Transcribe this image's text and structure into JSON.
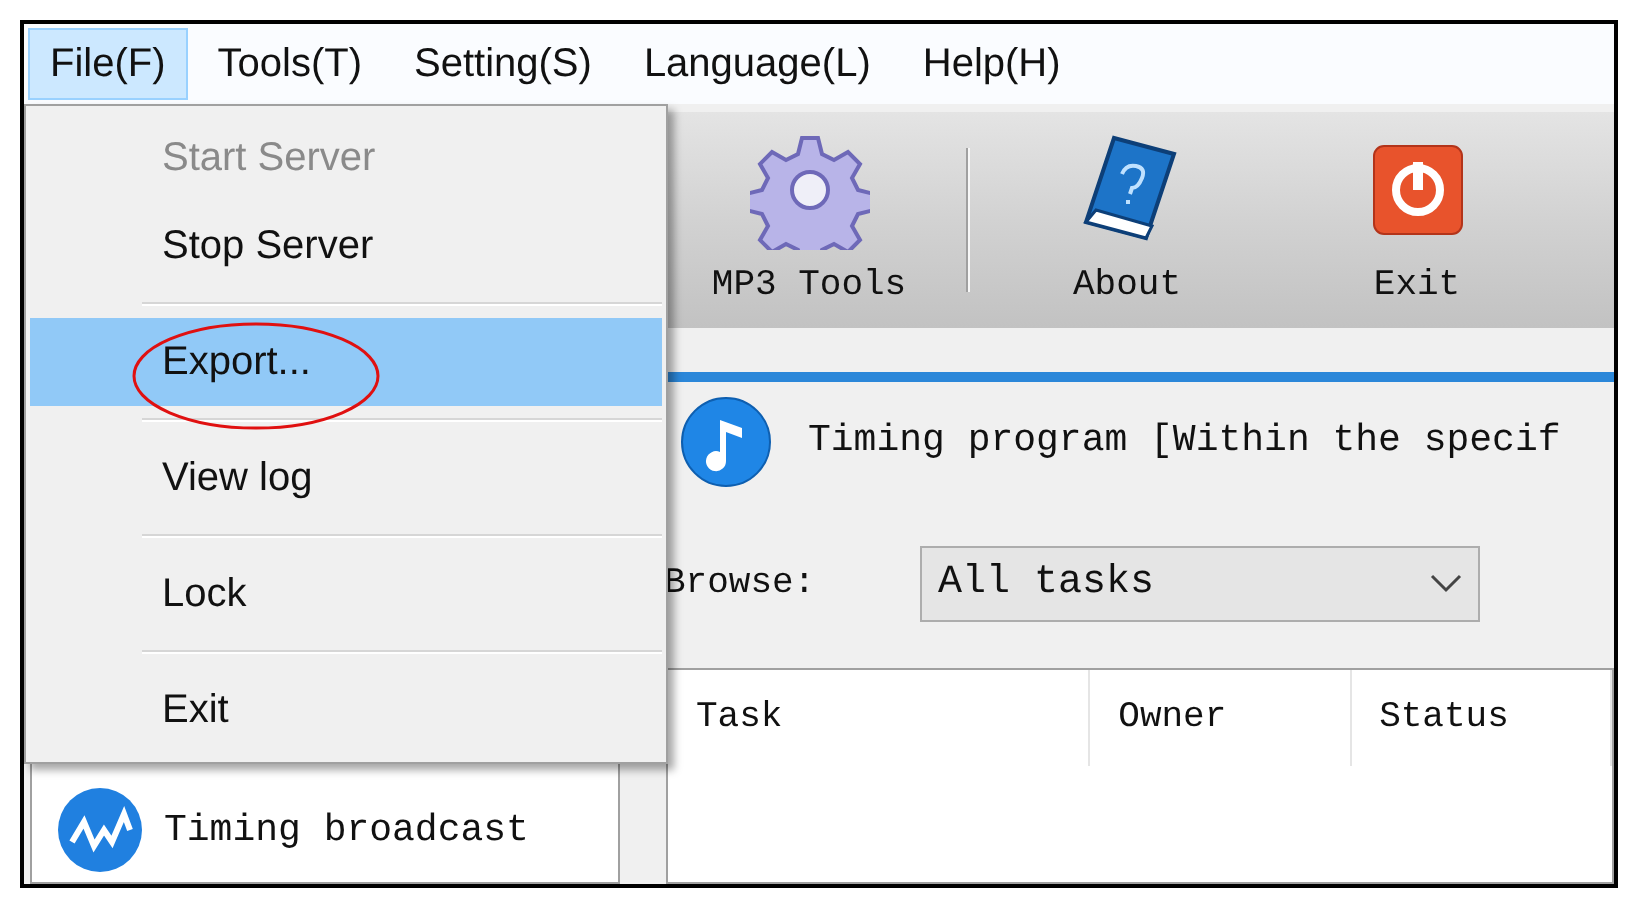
{
  "menu_bar": [
    {
      "label": "File(F)",
      "selected": true
    },
    {
      "label": "Tools(T)",
      "selected": false
    },
    {
      "label": "Setting(S)",
      "selected": false
    },
    {
      "label": "Language(L)",
      "selected": false
    },
    {
      "label": "Help(H)",
      "selected": false
    }
  ],
  "file_menu": [
    {
      "kind": "item",
      "label": "Start Server",
      "disabled": true,
      "selected": false
    },
    {
      "kind": "item",
      "label": "Stop Server",
      "disabled": false,
      "selected": false
    },
    {
      "kind": "separator"
    },
    {
      "kind": "item",
      "label": "Export...",
      "disabled": false,
      "selected": true
    },
    {
      "kind": "separator"
    },
    {
      "kind": "item",
      "label": "View log",
      "disabled": false,
      "selected": false
    },
    {
      "kind": "separator"
    },
    {
      "kind": "item",
      "label": "Lock",
      "disabled": false,
      "selected": false
    },
    {
      "kind": "separator"
    },
    {
      "kind": "item",
      "label": "Exit",
      "disabled": false,
      "selected": false
    }
  ],
  "toolbar": [
    {
      "kind": "gear",
      "label": "MP3 Tools"
    },
    {
      "kind": "separator"
    },
    {
      "kind": "book",
      "label": "About"
    },
    {
      "kind": "power",
      "label": "Exit"
    }
  ],
  "sidebar": {
    "items": [
      {
        "label": "Timing broadcast"
      }
    ]
  },
  "content": {
    "title": "Timing program [Within the specif",
    "browse": {
      "label": "Browse:",
      "value": "All tasks"
    },
    "table": {
      "columns": [
        "Task",
        "Owner",
        "Status"
      ]
    }
  }
}
